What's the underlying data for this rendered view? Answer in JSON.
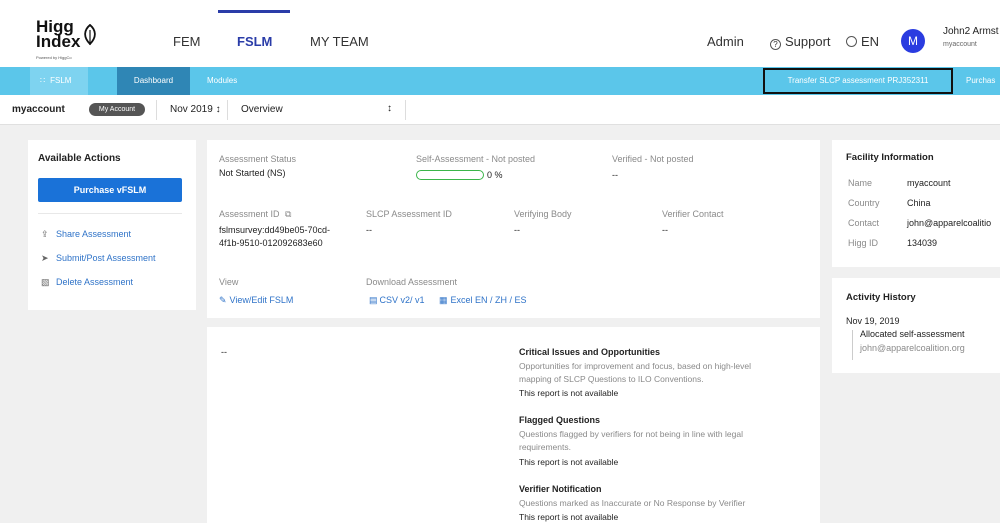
{
  "header": {
    "logo_line1": "Higg",
    "logo_line2": "Index",
    "logo_by": "Powered by HiggCo",
    "nav": [
      "FEM",
      "FSLM",
      "MY TEAM"
    ],
    "admin": "Admin",
    "support": "Support",
    "language": "EN",
    "avatar_initial": "M",
    "user_name": "John2 Armst",
    "user_account": "myaccount"
  },
  "bluebar": {
    "fslm": "FSLM",
    "dashboard": "Dashboard",
    "modules": "Modules",
    "transfer": "Transfer SLCP assessment PRJ352311",
    "purchase": "Purchas"
  },
  "subbar": {
    "account": "myaccount",
    "badge": "My Account",
    "date": "Nov 2019 ↕",
    "view": "Overview",
    "caret": "↕"
  },
  "actions": {
    "title": "Available Actions",
    "purchase_btn": "Purchase vFSLM",
    "share": "Share Assessment",
    "submit": "Submit/Post Assessment",
    "delete": "Delete Assessment"
  },
  "status": {
    "status_label": "Assessment Status",
    "status_value": "Not Started (NS)",
    "self_label": "Self-Assessment - Not posted",
    "self_pct": "0 %",
    "self_progress": 0,
    "verified_label": "Verified - Not posted",
    "verified_value": "--",
    "id_label": "Assessment ID",
    "id_line1": "fslmsurvey:dd49be05-70cd-",
    "id_line2": "4f1b-9510-012092683e60",
    "slcp_label": "SLCP Assessment ID",
    "slcp_value": "--",
    "vb_label": "Verifying Body",
    "vb_value": "--",
    "vc_label": "Verifier Contact",
    "vc_value": "--",
    "view_label": "View",
    "view_link": "View/Edit FSLM",
    "download_label": "Download Assessment",
    "csv_link": "CSV v2/ v1",
    "excel_link": "Excel EN / ZH / ES"
  },
  "reports": {
    "left_value": "--",
    "critical_title": "Critical Issues and Opportunities",
    "critical_desc1": "Opportunities for improvement and focus, based on high-level",
    "critical_desc2": "mapping of SLCP Questions to ILO Conventions.",
    "critical_na": "This report is not available",
    "flagged_title": "Flagged Questions",
    "flagged_desc1": "Questions flagged by verifiers for not being in line with legal",
    "flagged_desc2": "requirements.",
    "flagged_na": "This report is not available",
    "verifier_title": "Verifier Notification",
    "verifier_desc1": "Questions marked as Inaccurate or No Response by Verifier",
    "verifier_na": "This report is not available"
  },
  "facility": {
    "title": "Facility Information",
    "name_label": "Name",
    "name_value": "myaccount",
    "country_label": "Country",
    "country_value": "China",
    "contact_label": "Contact",
    "contact_value": "john@apparelcoalitio",
    "higg_label": "Higg ID",
    "higg_value": "134039"
  },
  "activity": {
    "title": "Activity History",
    "date": "Nov 19, 2019",
    "event": "Allocated self-assessment",
    "email": "john@apparelcoalition.org"
  },
  "colors": {
    "brand_blue": "#2a3ca8",
    "bluebar": "#5bc6ea",
    "dashboard_tab": "#2f86b5",
    "primary_button": "#1a72d8",
    "link": "#2f73c8",
    "progress_border": "#3bb54a"
  }
}
